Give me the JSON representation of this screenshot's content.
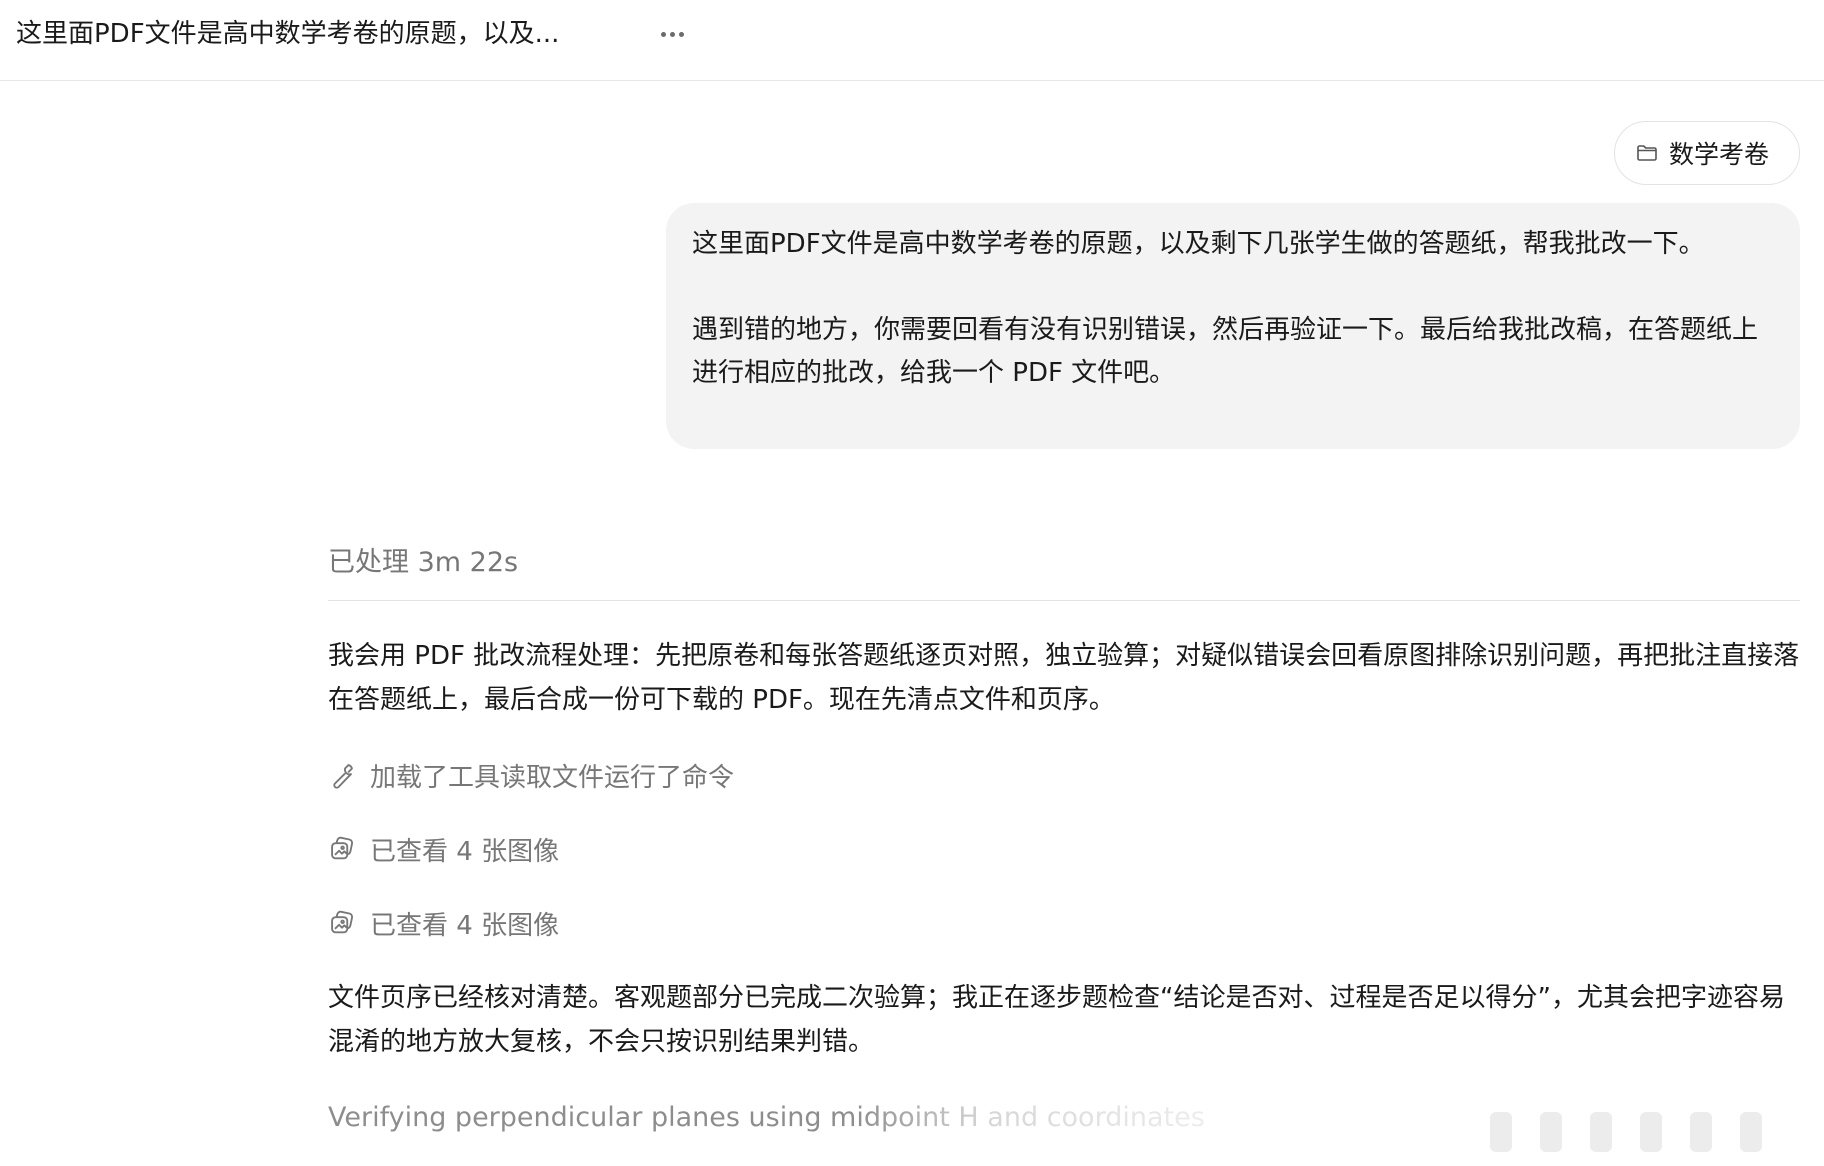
{
  "header": {
    "title": "这里面PDF文件是高中数学考卷的原题，以及...",
    "more_icon": "more-horizontal-icon"
  },
  "project_chip": {
    "label": "数学考卷",
    "icon": "folder-icon"
  },
  "user_message": {
    "paragraph_1": "这里面PDF文件是高中数学考卷的原题，以及剩下几张学生做的答题纸，帮我批改一下。",
    "paragraph_2": "遇到错的地方，你需要回看有没有识别错误，然后再验证一下。最后给我批改稿，在答题纸上进行相应的批改，给我一个 PDF 文件吧。"
  },
  "processing": {
    "status": "已处理 3m 22s"
  },
  "assistant": {
    "message_1": "我会用 PDF 批改流程处理：先把原卷和每张答题纸逐页对照，独立验算；对疑似错误会回看原图排除识别问题，再把批注直接落在答题纸上，最后合成一份可下载的 PDF。现在先清点文件和页序。",
    "tool_steps": [
      {
        "label": "加载了工具读取文件运行了命令",
        "icon": "wrench-icon"
      },
      {
        "label": "已查看 4 张图像",
        "icon": "images-icon"
      },
      {
        "label": "已查看 4 张图像",
        "icon": "images-icon"
      }
    ],
    "message_2": "文件页序已经核对清楚。客观题部分已完成二次验算；我正在逐步题检查“结论是否对、过程是否足以得分”，尤其会把字迹容易混淆的地方放大复核，不会只按识别结果判错。",
    "thinking_status": "Verifying perpendicular planes using midpoint H and coordinates"
  }
}
